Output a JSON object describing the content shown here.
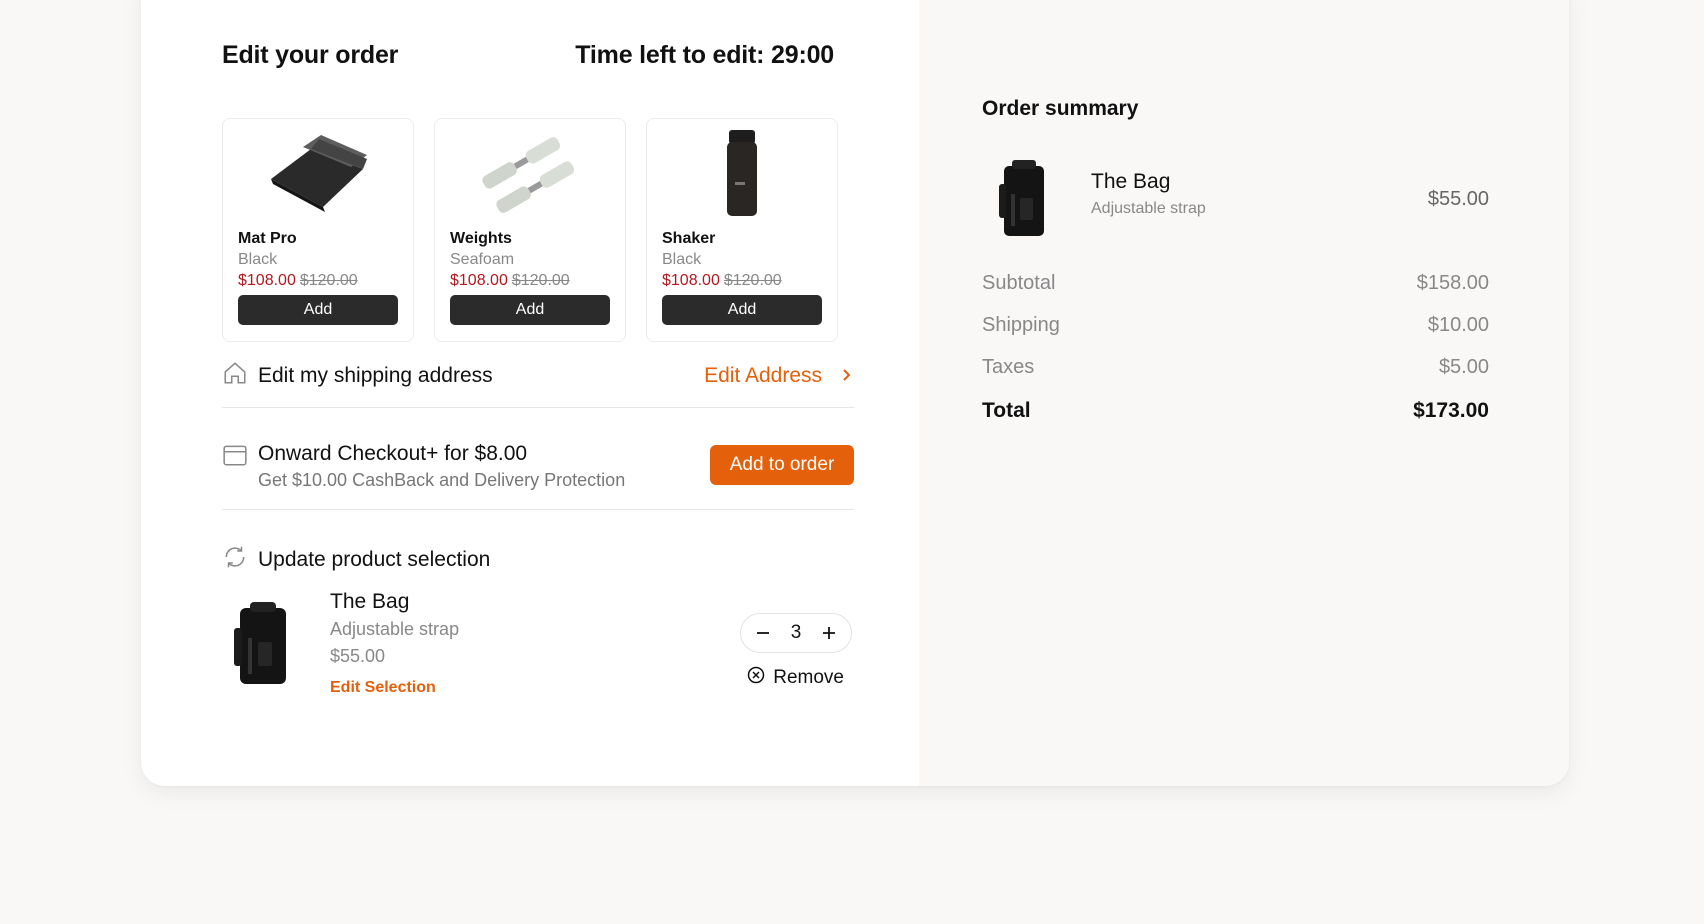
{
  "header": {
    "title": "Edit your order",
    "timer": "Time left to edit: 29:00"
  },
  "upsell": [
    {
      "name": "Mat Pro",
      "variant": "Black",
      "sale_price": "$108.00",
      "original_price": "$120.00",
      "button": "Add",
      "icon": "yoga-mat-image"
    },
    {
      "name": "Weights",
      "variant": "Seafoam",
      "sale_price": "$108.00",
      "original_price": "$120.00",
      "button": "Add",
      "icon": "dumbbells-image"
    },
    {
      "name": "Shaker",
      "variant": "Black",
      "sale_price": "$108.00",
      "original_price": "$120.00",
      "button": "Add",
      "icon": "shaker-bottle-image"
    }
  ],
  "shipping": {
    "label": "Edit my shipping address",
    "link": "Edit Address"
  },
  "onward": {
    "title": "Onward Checkout+ for $8.00",
    "subtitle": "Get $10.00 CashBack and Delivery Protection",
    "button": "Add to order"
  },
  "update": {
    "label": "Update product selection",
    "item": {
      "name": "The Bag",
      "variant": "Adjustable strap",
      "price": "$55.00",
      "edit_link": "Edit Selection",
      "quantity": "3",
      "remove": "Remove"
    }
  },
  "summary": {
    "title": "Order summary",
    "item": {
      "name": "The Bag",
      "variant": "Adjustable strap",
      "price": "$55.00"
    },
    "lines": [
      {
        "label": "Subtotal",
        "value": "$158.00"
      },
      {
        "label": "Shipping",
        "value": "$10.00"
      },
      {
        "label": "Taxes",
        "value": "$5.00"
      }
    ],
    "total": {
      "label": "Total",
      "value": "$173.00"
    }
  },
  "colors": {
    "accent": "#e4600a",
    "sale": "#b3181f",
    "button_dark": "#2b2b2b"
  }
}
